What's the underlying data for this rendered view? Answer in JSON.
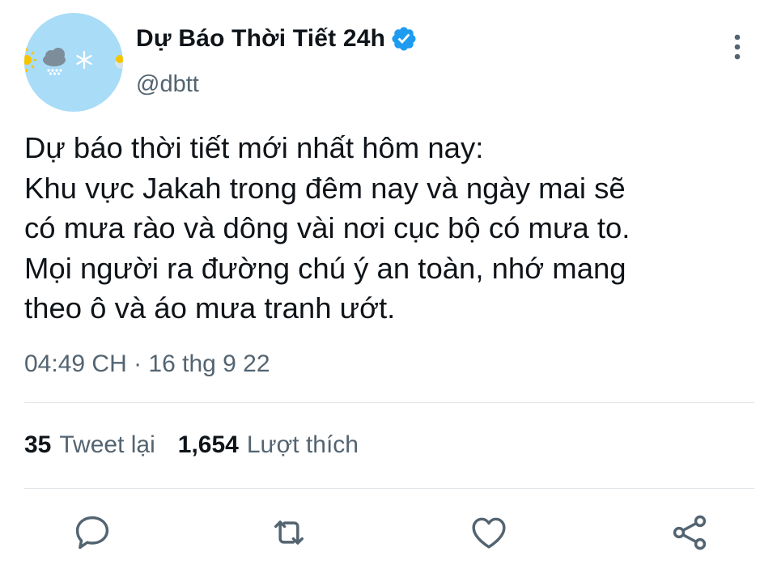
{
  "account": {
    "display_name": "Dự Báo Thời Tiết 24h",
    "handle": "@dbtt",
    "verified": true,
    "avatar_bg": "#a9dcf7"
  },
  "tweet": {
    "lines": [
      "Dự báo thời tiết mới nhất hôm nay:",
      "Khu vực Jakah trong đêm nay và ngày mai sẽ",
      "có mưa rào và dông vài nơi cục bộ có mưa to.",
      "Mọi người ra đường chú ý an toàn, nhớ mang",
      "theo ô và áo mưa tranh ướt."
    ],
    "timestamp": "04:49 CH · 16 thg 9 22"
  },
  "stats": {
    "retweets_count": "35",
    "retweets_label": "Tweet lại",
    "likes_count": "1,654",
    "likes_label": "Lượt thích"
  },
  "actions": [
    {
      "icon": "reply-icon"
    },
    {
      "icon": "retweet-icon"
    },
    {
      "icon": "like-icon"
    },
    {
      "icon": "share-icon"
    }
  ],
  "colors": {
    "text": "#0f1419",
    "secondary": "#536471",
    "verified": "#1d9bf0",
    "divider": "#e1e6ea"
  }
}
